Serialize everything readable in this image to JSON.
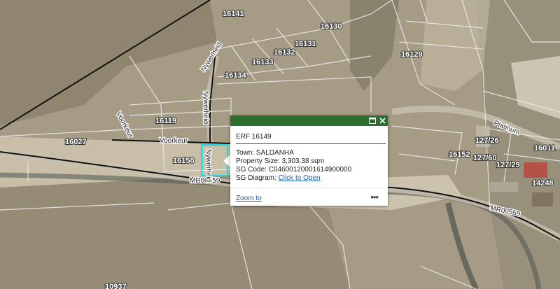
{
  "map": {
    "parcel_labels": [
      "16141",
      "16130",
      "16131",
      "16132",
      "16133",
      "16134",
      "16129",
      "16119",
      "16027",
      "16150",
      "16152",
      "127/26",
      "127/60",
      "127/29",
      "16011",
      "14248",
      "10937"
    ],
    "road_labels": [
      "Nywerheid",
      "Nywerheid",
      "Voorkeur",
      "Voorkeur",
      "MR00559",
      "MR00559",
      "Platinum"
    ],
    "colors": {
      "highlight": "#21d4e0",
      "popup_header": "#2b6e2f",
      "link": "#1a5fb4"
    }
  },
  "popup": {
    "title": "ERF 16149",
    "town_label": "Town:",
    "town_value": "SALDANHA",
    "size_label": "Property Size:",
    "size_value": "3,303.38 sqm",
    "sg_code_label": "SG Code:",
    "sg_code_value": "C04600120001614900000",
    "sg_diagram_label": "SG Diagram:",
    "sg_diagram_link": "Click to Open",
    "zoom_label": "Zoom to",
    "more_label": "•••",
    "dock_icon": "dock-icon",
    "close_icon": "close-icon"
  }
}
